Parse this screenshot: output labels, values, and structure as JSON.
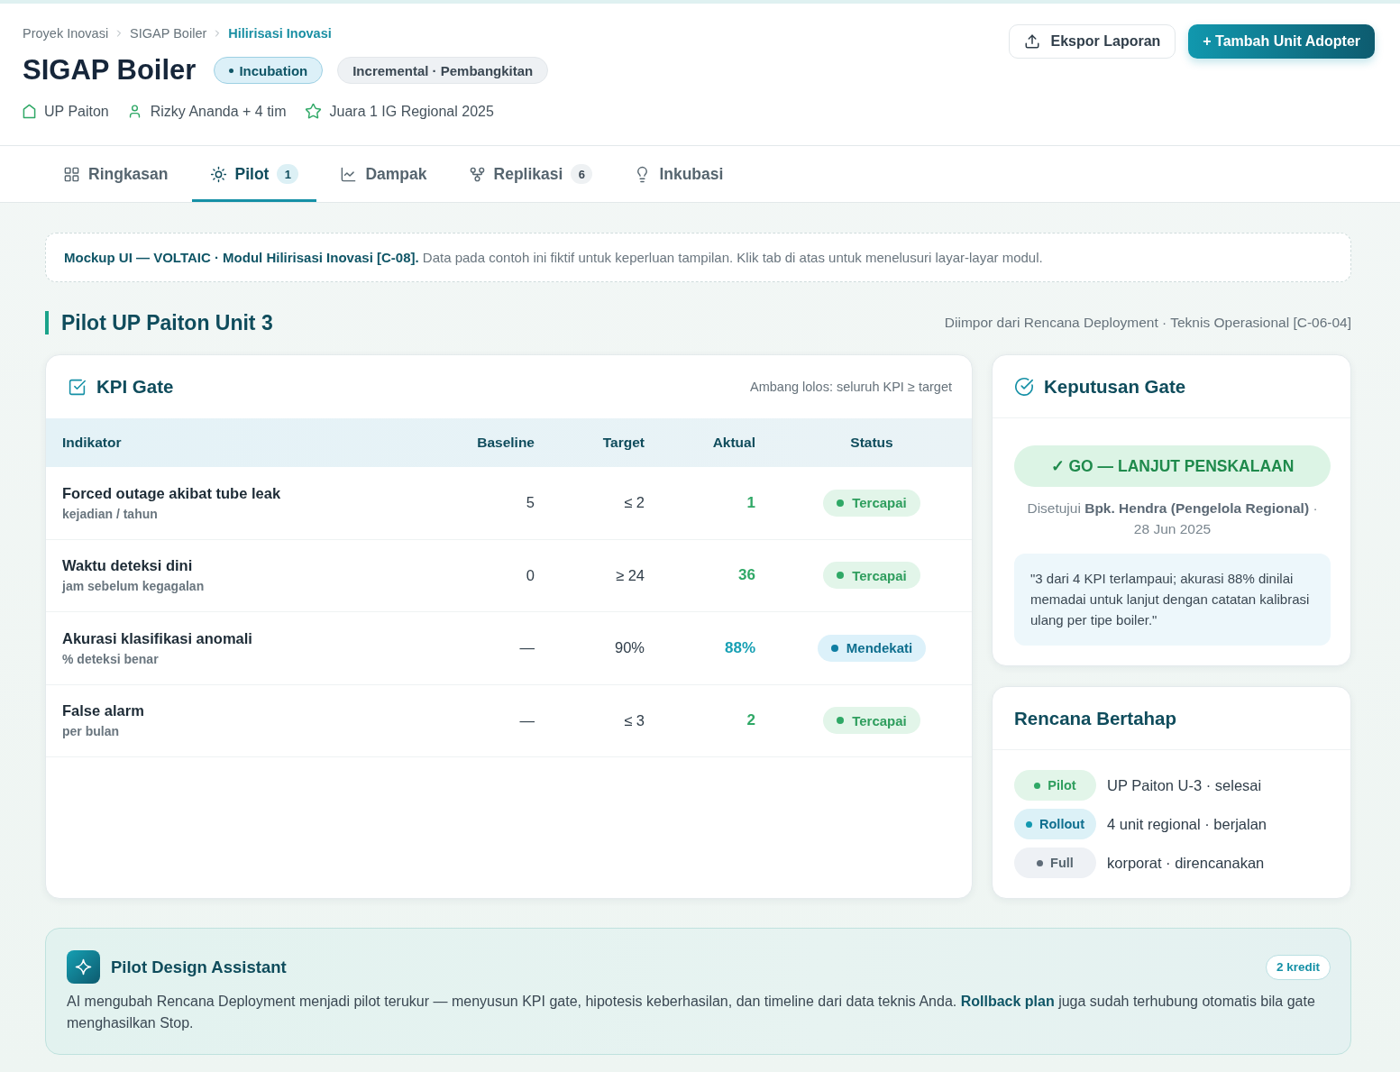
{
  "breadcrumb": [
    {
      "label": "Proyek Inovasi",
      "current": false
    },
    {
      "label": "SIGAP Boiler",
      "current": false
    },
    {
      "label": "Hilirisasi Inovasi",
      "current": true
    }
  ],
  "title": "SIGAP Boiler",
  "badges": [
    {
      "label": "Incubation",
      "kind": "stage"
    },
    {
      "label": "Incremental · Pembangkitan",
      "kind": "category"
    }
  ],
  "meta": [
    {
      "label": "UP Paiton",
      "kind": "unit"
    },
    {
      "label": "Rizky Ananda + 4 tim",
      "kind": "team"
    },
    {
      "label": "Juara 1 IG Regional 2025",
      "kind": "award"
    }
  ],
  "actions": [
    {
      "label": "Ekspor Laporan",
      "kind": "secondary"
    },
    {
      "label": "+ Tambah Unit Adopter",
      "kind": "primary"
    }
  ],
  "tabs": [
    {
      "label": "Ringkasan",
      "kind": "overview",
      "selected": false
    },
    {
      "label": "Pilot",
      "kind": "pilot",
      "selected": true,
      "count": "1"
    },
    {
      "label": "Dampak",
      "kind": "impact",
      "selected": false
    },
    {
      "label": "Replikasi",
      "kind": "replication",
      "selected": false,
      "count": "6"
    },
    {
      "label": "Inkubasi",
      "kind": "incubation",
      "selected": false
    }
  ],
  "notice": "**Mockup UI — VOLTAIC · Modul Hilirisasi Inovasi [C-08].** Data pada contoh ini fiktif untuk keperluan tampilan. Klik tab di atas untuk menelusuri layar-layar modul.",
  "section": {
    "title": "Pilot UP Paiton Unit 3",
    "source": "Diimpor dari Rencana Deployment · Teknis Operasional [C-06-04]"
  },
  "kpi_gate": {
    "title": "KPI Gate",
    "threshold": "Ambang lolos: seluruh KPI ≥ target",
    "columns": [
      "Indikator",
      "Baseline",
      "Target",
      "Aktual",
      "Status"
    ],
    "rows": [
      {
        "indicator": "Forced outage akibat tube leak",
        "unit": "kejadian / tahun",
        "baseline": "5",
        "target": "≤ 2",
        "actual": "1",
        "status": {
          "label": "Tercapai",
          "kind": "achieved"
        }
      },
      {
        "indicator": "Waktu deteksi dini",
        "unit": "jam sebelum kegagalan",
        "baseline": "0",
        "target": "≥ 24",
        "actual": "36",
        "status": {
          "label": "Tercapai",
          "kind": "achieved"
        }
      },
      {
        "indicator": "Akurasi klasifikasi anomali",
        "unit": "% deteksi benar",
        "baseline": "—",
        "target": "90%",
        "actual": "88%",
        "status": {
          "label": "Mendekati",
          "kind": "near"
        }
      },
      {
        "indicator": "False alarm",
        "unit": "per bulan",
        "baseline": "—",
        "target": "≤ 3",
        "actual": "2",
        "status": {
          "label": "Tercapai",
          "kind": "achieved"
        }
      }
    ]
  },
  "gate_decision": {
    "title": "Keputusan Gate",
    "verdict": "✓ GO — LANJUT PENSKALAAN",
    "approval": "Disetujui **Bpk. Hendra (Pengelola Regional)** · 28 Jun 2025",
    "note": "\"3 dari 4 KPI terlampaui; akurasi 88% dinilai memadai untuk lanjut dengan catatan kalibrasi ulang per tipe boiler.\""
  },
  "phased_plan": {
    "title": "Rencana Bertahap",
    "phases": [
      {
        "label": "Pilot",
        "detail": "UP Paiton U-3 · selesai",
        "kind": "done"
      },
      {
        "label": "Rollout",
        "detail": "4 unit regional · berjalan",
        "kind": "running"
      },
      {
        "label": "Full",
        "detail": "korporat · direncanakan",
        "kind": "planned"
      }
    ]
  },
  "assistant": {
    "title": "Pilot Design Assistant",
    "credits": "2 kredit",
    "text": "AI mengubah Rencana Deployment menjadi pilot terukur — menyusun KPI gate, hipotesis keberhasilan, dan timeline dari data teknis Anda. **Rollback plan** juga sudah terhubung otomatis bila gate menghasilkan Stop."
  }
}
